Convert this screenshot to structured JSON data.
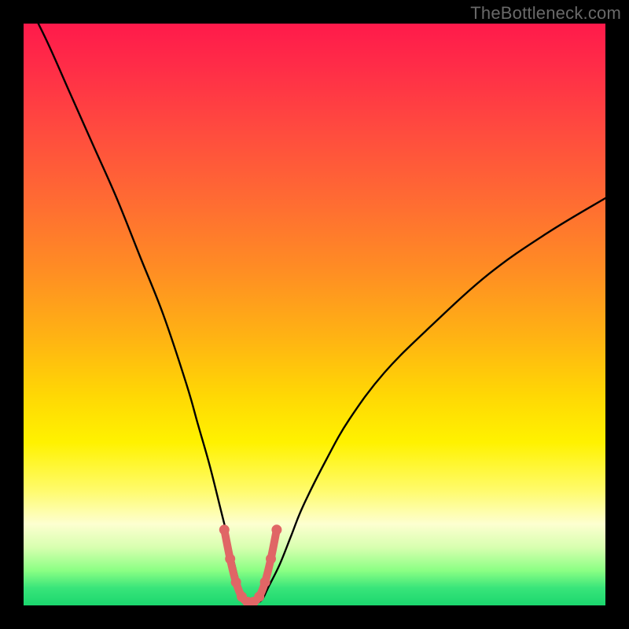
{
  "attribution": "TheBottleneck.com",
  "colors": {
    "page_bg": "#000000",
    "curve_stroke": "#000000",
    "highlight_stroke": "#e06666",
    "gradient_top": "#ff1a4b",
    "gradient_mid": "#fff200",
    "gradient_bottom": "#1bd66e"
  },
  "chart_data": {
    "type": "line",
    "title": "",
    "xlabel": "",
    "ylabel": "",
    "x_range": [
      0,
      100
    ],
    "y_range": [
      0,
      100
    ],
    "series": [
      {
        "name": "bottleneck-curve",
        "x": [
          0,
          4,
          8,
          12,
          16,
          20,
          24,
          28,
          30,
          32,
          34,
          36,
          37,
          38,
          39,
          40,
          41,
          42,
          44,
          46,
          48,
          52,
          56,
          62,
          70,
          80,
          90,
          100
        ],
        "y": [
          105,
          97,
          88,
          79,
          70,
          60,
          50,
          38,
          31,
          24,
          16,
          8,
          4,
          1,
          0.5,
          0.5,
          1,
          3,
          7,
          12,
          17,
          25,
          32,
          40,
          48,
          57,
          64,
          70
        ]
      }
    ],
    "highlight": {
      "name": "optimal-band",
      "x": [
        34.5,
        35.5,
        36.5,
        37.5,
        38.5,
        39.5,
        40.5,
        41.5,
        42.5,
        43.5
      ],
      "y": [
        13,
        8,
        4,
        1.5,
        0.6,
        0.6,
        1.5,
        4,
        8,
        13
      ]
    },
    "highlight_points": {
      "x": [
        34.5,
        35.5,
        36.5,
        37.5,
        38.5,
        39.5,
        40.5,
        41.5,
        42.5,
        43.5
      ],
      "y": [
        13,
        8,
        4,
        1.5,
        0.6,
        0.6,
        1.5,
        4,
        8,
        13
      ]
    }
  }
}
